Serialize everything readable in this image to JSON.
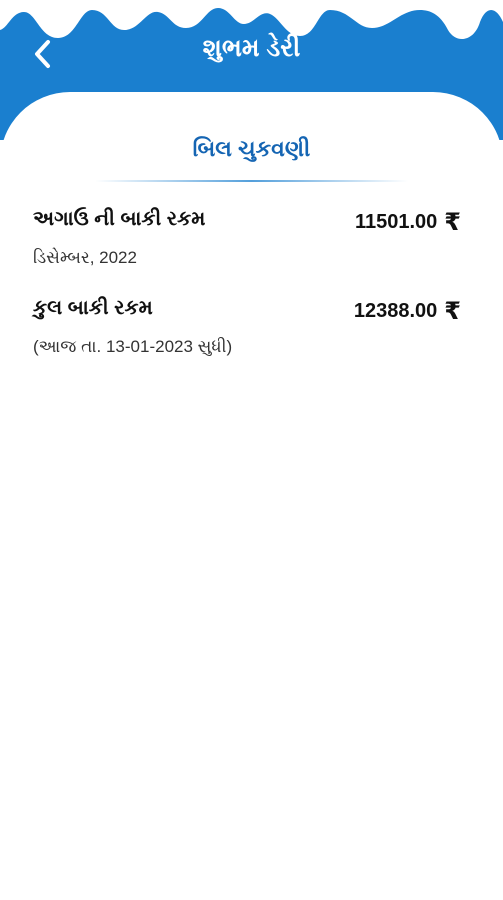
{
  "header": {
    "title": "શુભમ ડેરી",
    "back_icon": "chevron-left-icon",
    "color": "#1a7fcf"
  },
  "page": {
    "title": "બિલ ચુકવણી",
    "title_color": "#1565b3"
  },
  "rows": [
    {
      "label": "અગાઉ ની બાકી રકમ",
      "amount": "11501.00",
      "currency": "₹",
      "sub": "ડિસેમ્બર, 2022"
    },
    {
      "label": "કુલ બાકી રકમ",
      "amount": "12388.00",
      "currency": "₹",
      "sub": "(આજ તા. 13-01-2023 સુધી)"
    }
  ]
}
